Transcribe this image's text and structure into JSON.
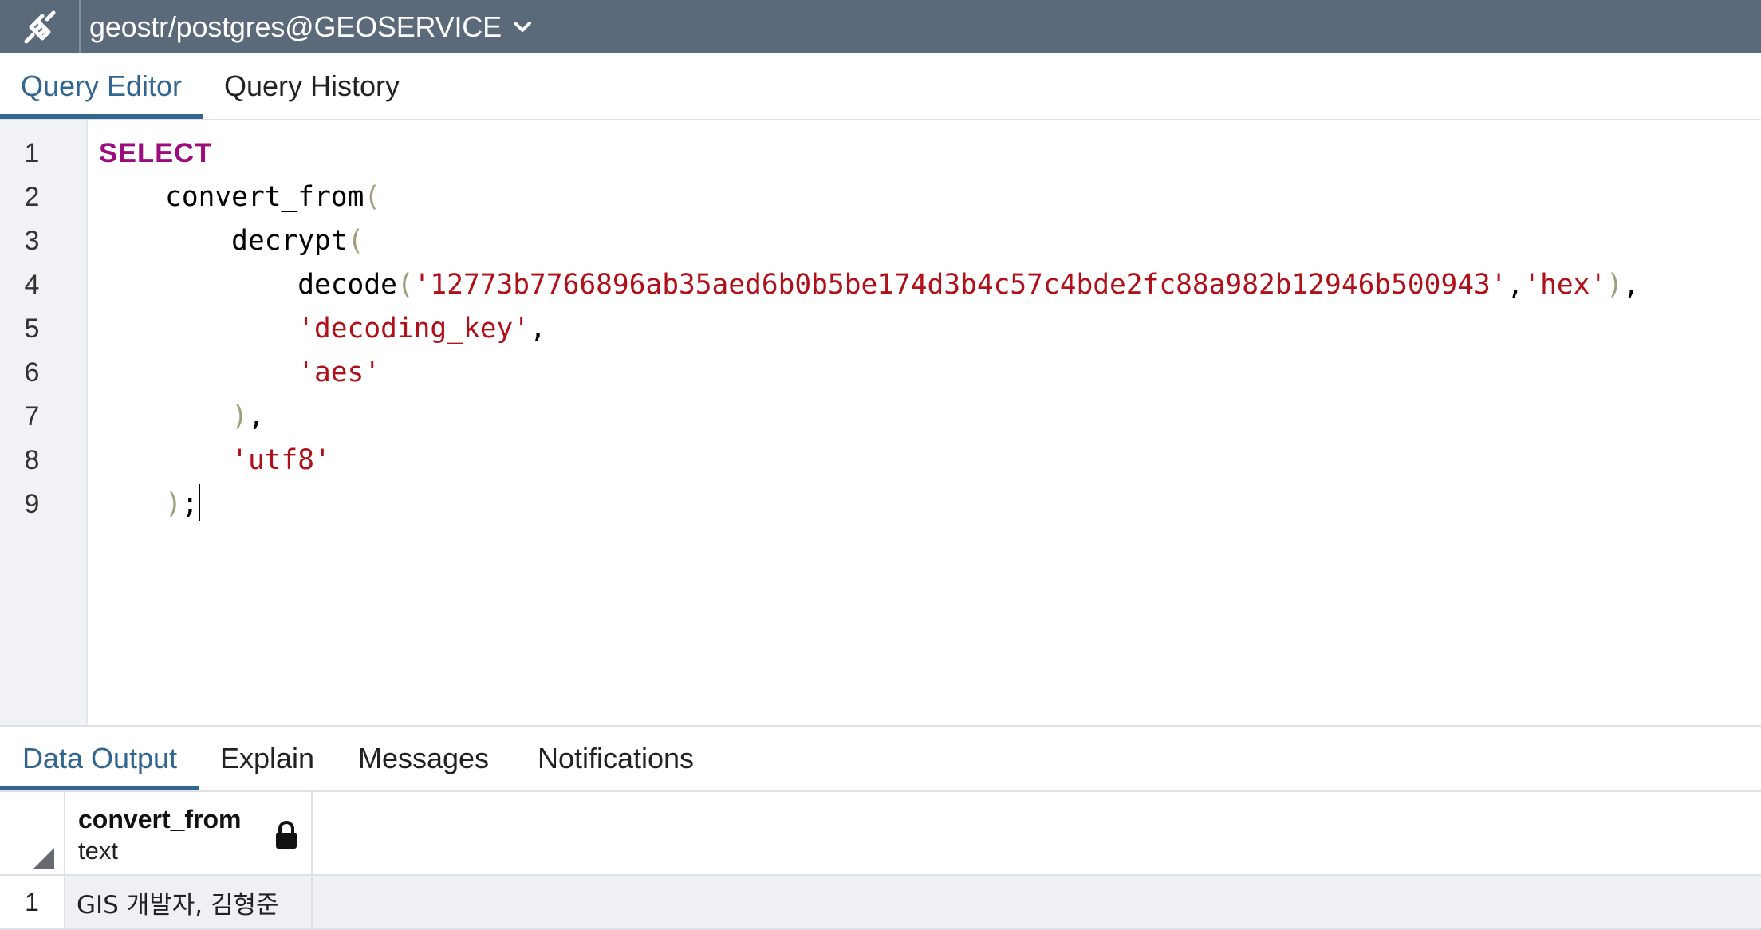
{
  "topbar": {
    "logo_icon": "plug-connected-icon",
    "connection": "geostr/postgres@GEOSERVICE",
    "dropdown_icon": "chevron-down-icon",
    "color": "#5b6a7b"
  },
  "editor_tabs": [
    {
      "label": "Query Editor",
      "active": true
    },
    {
      "label": "Query History",
      "active": false
    }
  ],
  "editor": {
    "line_numbers": [
      "1",
      "2",
      "3",
      "4",
      "5",
      "6",
      "7",
      "8",
      "9"
    ],
    "tokens": {
      "l1_kw": "SELECT",
      "l2_fn": "convert_from",
      "l3_fn": "decrypt",
      "l4_fn": "decode",
      "l4_hex": "'12773b7766896ab35aed6b0b5be174d3b4c57c4bde2fc88a982b12946b500943'",
      "l4_fmt": "'hex'",
      "l5_key": "'decoding_key'",
      "l6_alg": "'aes'",
      "l8_enc": "'utf8'"
    },
    "colors": {
      "keyword": "#9c0c7d",
      "string": "#b0101a",
      "paren": "#a19e7a"
    }
  },
  "result_tabs": [
    {
      "label": "Data Output",
      "active": true
    },
    {
      "label": "Explain",
      "active": false
    },
    {
      "label": "Messages",
      "active": false
    },
    {
      "label": "Notifications",
      "active": false
    }
  ],
  "grid": {
    "columns": [
      {
        "name": "convert_from",
        "type": "text",
        "icon": "lock-icon"
      }
    ],
    "rows": [
      {
        "num": "1",
        "values": [
          "GIS 개발자, 김형준"
        ]
      }
    ]
  },
  "accent": "#326690"
}
